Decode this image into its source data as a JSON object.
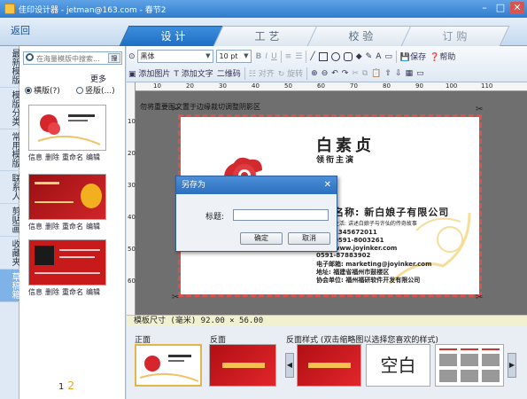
{
  "window": {
    "title": "佳印设计器 - jetman@163.com - 春节2",
    "minimize": "–",
    "maximize": "□",
    "close": "✕"
  },
  "nav": {
    "back": "返回",
    "tabs": [
      {
        "label": "设  计"
      },
      {
        "label": "工  艺"
      },
      {
        "label": "校  验"
      },
      {
        "label": "订  购"
      }
    ]
  },
  "categories": [
    "最新模版",
    "模版分类",
    "常用模版",
    "联系人",
    "剪贴画",
    "收藏夹",
    "草稿箱"
  ],
  "left": {
    "search_placeholder": "在海量模版中搜索...",
    "search_go": "搜",
    "more": "更多",
    "orient_horizontal": "横版(?)",
    "orient_vertical": "竖版(...)",
    "template_actions": [
      "信息",
      "删除",
      "重命名",
      "编辑"
    ],
    "page_prev": "1",
    "page_current": "2"
  },
  "toolbar": {
    "font": "黑体",
    "size": "10 pt",
    "bold": "B",
    "italic": "I",
    "underline": "U",
    "add_image": "添加图片",
    "add_text": "添加文字",
    "qrcode": "二维码",
    "align": "对齐",
    "rotate": "旋转",
    "save": "保存",
    "help": "帮助"
  },
  "canvas": {
    "notice": "勿将重要图文置于边缘裁切调整阴影区",
    "name": "白素贞",
    "role": "领衔主演",
    "company": "名称: 新白娘子有限公司",
    "slogan": "生活: 讲述白娘子与许仙的传奇故事",
    "lines": [
      "2345672011",
      "0591-8003261",
      "www.joyinker.com",
      "0591-87883902",
      "电子邮箱: marketing@joyinker.com",
      "地址: 福建省福州市鼓楼区",
      "协会单位: 福州福研软件开发有限公司"
    ],
    "ruler_h": [
      "10",
      "20",
      "30",
      "40",
      "50",
      "60",
      "70",
      "80",
      "90",
      "100",
      "110"
    ],
    "ruler_v": [
      "10",
      "20",
      "30",
      "40",
      "50",
      "60"
    ]
  },
  "sizebar": "模板尺寸 (毫米) 92.00 × 56.00",
  "bottom": {
    "front": "正面",
    "back": "反面",
    "back_style": "反面样式 (双击缩略图以选择您喜欢的样式)",
    "blank": "空白"
  },
  "dialog": {
    "title": "另存为",
    "label": "标题:",
    "value": "",
    "ok": "确定",
    "cancel": "取消"
  },
  "colors": {
    "accent": "#1d6fc4",
    "card_red": "#c81a1a",
    "notice_bar": "#f1f1d2"
  }
}
